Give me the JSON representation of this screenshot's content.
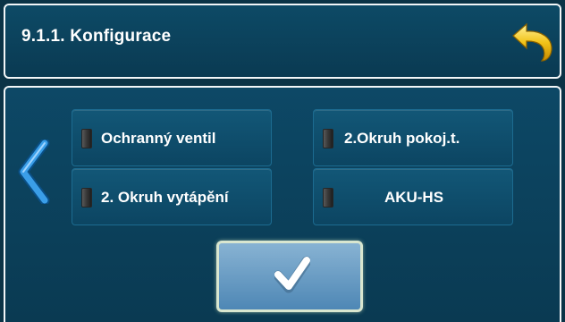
{
  "header": {
    "title": "9.1.1. Konfigurace",
    "back_icon": "undo-arrow-icon"
  },
  "navigation": {
    "prev_icon": "chevron-left-icon"
  },
  "options": [
    {
      "label": "Ochranný ventil",
      "indicator": "off"
    },
    {
      "label": "2.Okruh pokoj.t.",
      "indicator": "off"
    },
    {
      "label": "2. Okruh vytápění",
      "indicator": "off"
    },
    {
      "label": "AKU-HS",
      "indicator": "off"
    }
  ],
  "confirm": {
    "icon": "checkmark-icon"
  },
  "colors": {
    "background": "#0b3346",
    "panel": "#0d4a66",
    "tile": "#125777",
    "border": "#f2f6f8",
    "back_arrow": "#f2c318",
    "chevron": "#3a9ee8",
    "confirm_button": "#6c9dc4"
  }
}
